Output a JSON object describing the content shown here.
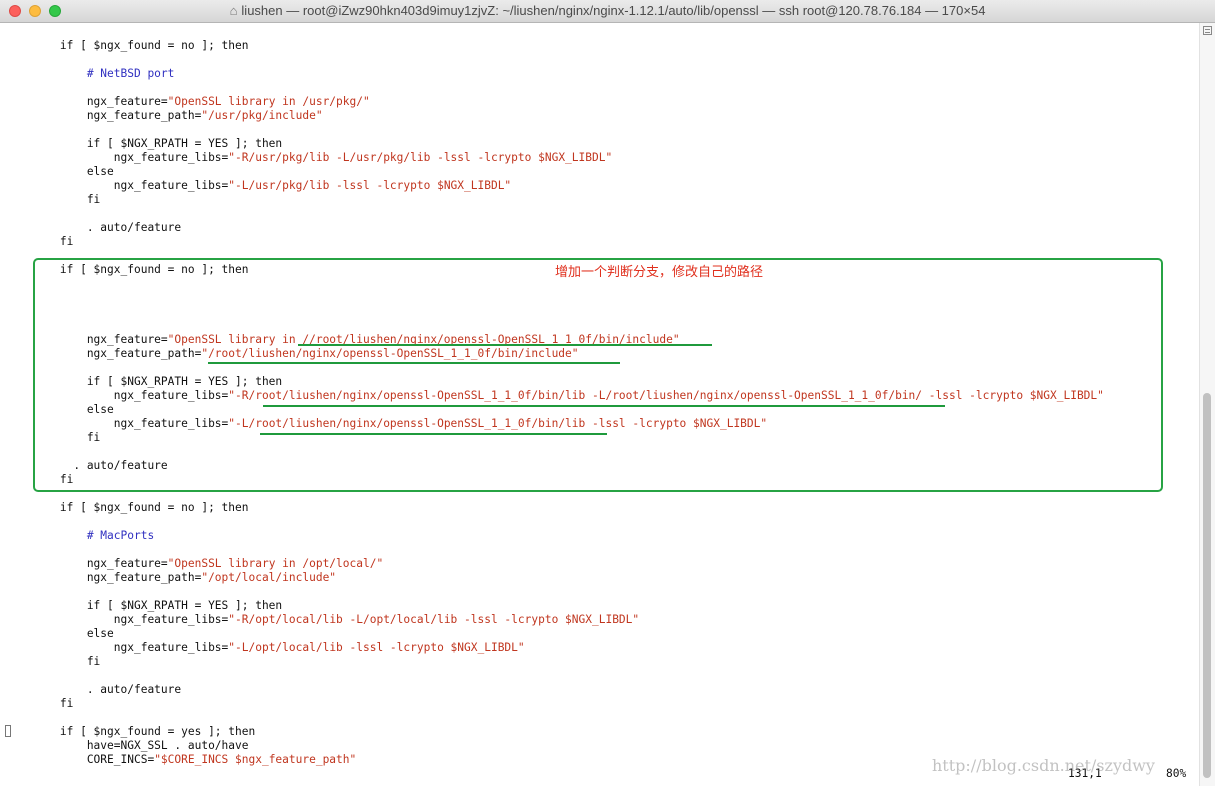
{
  "window": {
    "title": "liushen — root@iZwz90hkn403d9imuy1zjvZ: ~/liushen/nginx/nginx-1.12.1/auto/lib/openssl — ssh root@120.78.76.184 — 170×54"
  },
  "lines": [
    [
      {
        "t": "        if [ $ngx_found = no ]; then"
      }
    ],
    [
      {
        "t": ""
      }
    ],
    [
      {
        "t": "            "
      },
      {
        "t": "# NetBSD port",
        "k": "c"
      }
    ],
    [
      {
        "t": ""
      }
    ],
    [
      {
        "t": "            ngx_feature="
      },
      {
        "t": "\"OpenSSL library in /usr/pkg/\"",
        "k": "s"
      }
    ],
    [
      {
        "t": "            ngx_feature_path="
      },
      {
        "t": "\"/usr/pkg/include\"",
        "k": "s"
      }
    ],
    [
      {
        "t": ""
      }
    ],
    [
      {
        "t": "            if [ $NGX_RPATH = YES ]; then"
      }
    ],
    [
      {
        "t": "                ngx_feature_libs="
      },
      {
        "t": "\"-R/usr/pkg/lib -L/usr/pkg/lib -lssl -lcrypto $NGX_LIBDL\"",
        "k": "s"
      }
    ],
    [
      {
        "t": "            else"
      }
    ],
    [
      {
        "t": "                ngx_feature_libs="
      },
      {
        "t": "\"-L/usr/pkg/lib -lssl -lcrypto $NGX_LIBDL\"",
        "k": "s"
      }
    ],
    [
      {
        "t": "            fi"
      }
    ],
    [
      {
        "t": ""
      }
    ],
    [
      {
        "t": "            . auto/feature"
      }
    ],
    [
      {
        "t": "        fi"
      }
    ],
    [
      {
        "t": ""
      }
    ],
    [
      {
        "t": "        if [ $ngx_found = no ]; then"
      }
    ],
    [
      {
        "t": ""
      }
    ],
    [
      {
        "t": ""
      }
    ],
    [
      {
        "t": ""
      }
    ],
    [
      {
        "t": ""
      }
    ],
    [
      {
        "t": "            ngx_feature="
      },
      {
        "t": "\"OpenSSL library in //root/liushen/nginx/openssl-OpenSSL_1_1_0f/bin/include\"",
        "k": "s"
      }
    ],
    [
      {
        "t": "            ngx_feature_path="
      },
      {
        "t": "\"/root/liushen/nginx/openssl-OpenSSL_1_1_0f/bin/include\"",
        "k": "s"
      }
    ],
    [
      {
        "t": ""
      }
    ],
    [
      {
        "t": "            if [ $NGX_RPATH = YES ]; then"
      }
    ],
    [
      {
        "t": "                ngx_feature_libs="
      },
      {
        "t": "\"-R/root/liushen/nginx/openssl-OpenSSL_1_1_0f/bin/lib -L/root/liushen/nginx/openssl-OpenSSL_1_1_0f/bin/ -lssl -lcrypto $NGX_LIBDL\"",
        "k": "s"
      }
    ],
    [
      {
        "t": "            else"
      }
    ],
    [
      {
        "t": "                ngx_feature_libs="
      },
      {
        "t": "\"-L/root/liushen/nginx/openssl-OpenSSL_1_1_0f/bin/lib -lssl -lcrypto $NGX_LIBDL\"",
        "k": "s"
      }
    ],
    [
      {
        "t": "            fi"
      }
    ],
    [
      {
        "t": ""
      }
    ],
    [
      {
        "t": "          . auto/feature"
      }
    ],
    [
      {
        "t": "        fi"
      }
    ],
    [
      {
        "t": ""
      }
    ],
    [
      {
        "t": "        if [ $ngx_found = no ]; then"
      }
    ],
    [
      {
        "t": ""
      }
    ],
    [
      {
        "t": "            "
      },
      {
        "t": "# MacPorts",
        "k": "c"
      }
    ],
    [
      {
        "t": ""
      }
    ],
    [
      {
        "t": "            ngx_feature="
      },
      {
        "t": "\"OpenSSL library in /opt/local/\"",
        "k": "s"
      }
    ],
    [
      {
        "t": "            ngx_feature_path="
      },
      {
        "t": "\"/opt/local/include\"",
        "k": "s"
      }
    ],
    [
      {
        "t": ""
      }
    ],
    [
      {
        "t": "            if [ $NGX_RPATH = YES ]; then"
      }
    ],
    [
      {
        "t": "                ngx_feature_libs="
      },
      {
        "t": "\"-R/opt/local/lib -L/opt/local/lib -lssl -lcrypto $NGX_LIBDL\"",
        "k": "s"
      }
    ],
    [
      {
        "t": "            else"
      }
    ],
    [
      {
        "t": "                ngx_feature_libs="
      },
      {
        "t": "\"-L/opt/local/lib -lssl -lcrypto $NGX_LIBDL\"",
        "k": "s"
      }
    ],
    [
      {
        "t": "            fi"
      }
    ],
    [
      {
        "t": ""
      }
    ],
    [
      {
        "t": "            . auto/feature"
      }
    ],
    [
      {
        "t": "        fi"
      }
    ],
    [
      {
        "t": ""
      }
    ],
    [
      {
        "t": "        if [ $ngx_found = yes ]; then"
      }
    ],
    [
      {
        "t": "            have=NGX_SSL . auto/have"
      }
    ],
    [
      {
        "t": "            CORE_INCS="
      },
      {
        "t": "\"$CORE_INCS $ngx_feature_path\"",
        "k": "s"
      }
    ]
  ],
  "annotation": {
    "note": "增加一个判断分支，修改自己的路径",
    "color": "#e0301e",
    "box_color": "#27a344"
  },
  "status": {
    "position": "131,1",
    "percent": "80%"
  },
  "watermark": "http://blog.csdn.net/szydwy",
  "colors": {
    "string": "#c0361f",
    "comment": "#3030c0",
    "text": "#111111"
  }
}
